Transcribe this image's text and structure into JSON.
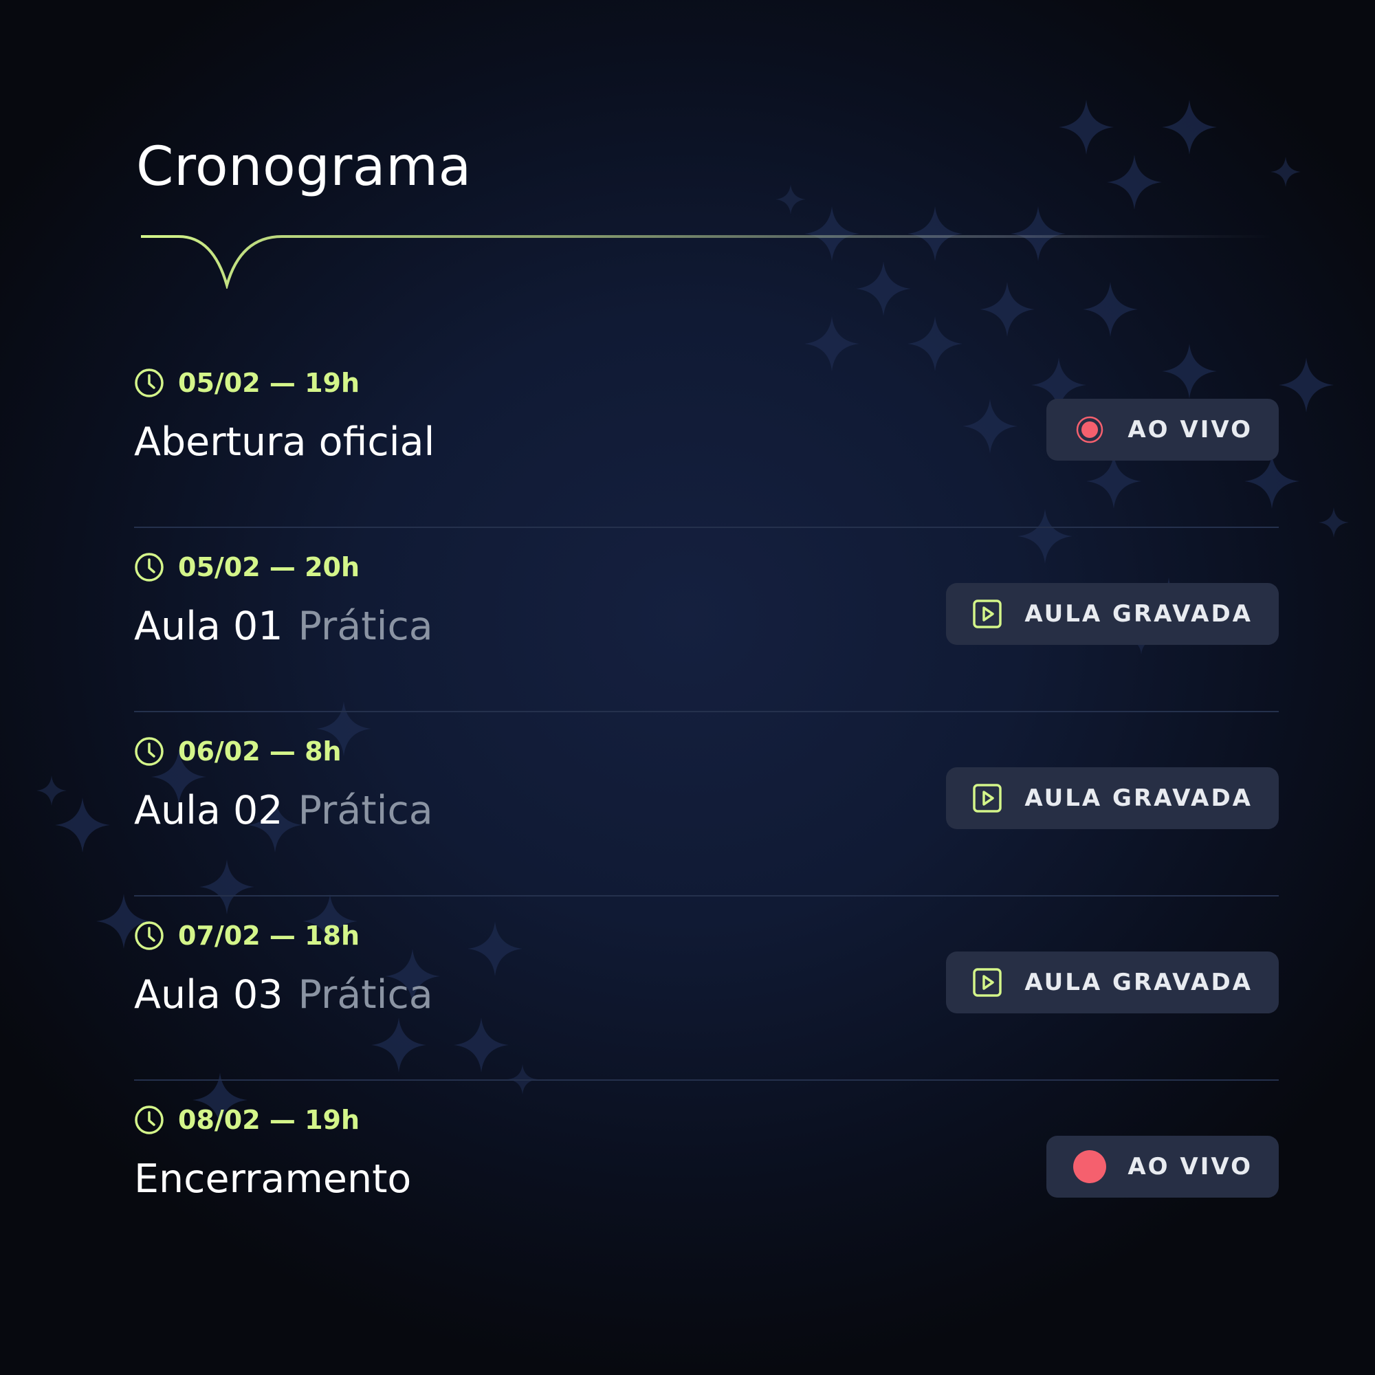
{
  "page": {
    "title": "Cronograma"
  },
  "colors": {
    "accent": "#d4f58a",
    "live": "#f5606e",
    "badge_bg": "#272f45",
    "subtitle": "#8b94a3"
  },
  "schedule": [
    {
      "time": "05/02 — 19h",
      "title": "Abertura oficial",
      "subtitle": "",
      "badge": {
        "label": "AO VIVO",
        "icon": "live-record-icon"
      }
    },
    {
      "time": "05/02 — 20h",
      "title": "Aula 01",
      "subtitle": "Prática",
      "badge": {
        "label": "AULA GRAVADA",
        "icon": "play-icon"
      }
    },
    {
      "time": "06/02 — 8h",
      "title": "Aula 02",
      "subtitle": "Prática",
      "badge": {
        "label": "AULA GRAVADA",
        "icon": "play-icon"
      }
    },
    {
      "time": "07/02 — 18h",
      "title": "Aula 03",
      "subtitle": "Prática",
      "badge": {
        "label": "AULA GRAVADA",
        "icon": "play-icon"
      }
    },
    {
      "time": "08/02 — 19h",
      "title": "Encerramento",
      "subtitle": "",
      "badge": {
        "label": "AO VIVO",
        "icon": "live-dot-icon"
      }
    }
  ]
}
